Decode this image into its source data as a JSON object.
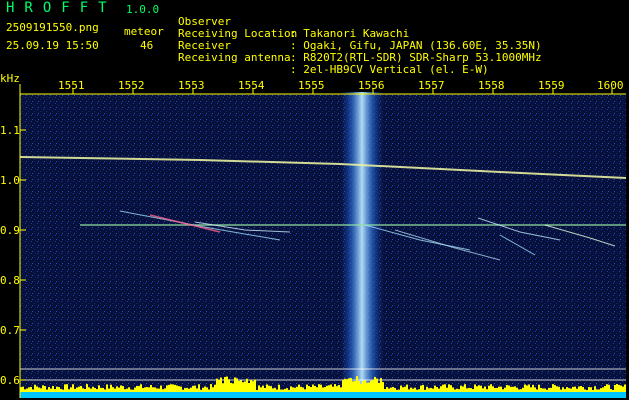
{
  "header": {
    "app_name": "HROFFT",
    "version": "1.0.0",
    "filename": "2509191550.png",
    "datetime": "25.09.19 15:50",
    "meteor_label": "meteor",
    "meteor_count": "46"
  },
  "metadata": [
    {
      "key": "Observer",
      "value": ": Takanori Kawachi"
    },
    {
      "key": "Receiving Location",
      "value": ": Ogaki, Gifu, JAPAN (136.60E, 35.35N)"
    },
    {
      "key": "Receiver",
      "value": ": R820T2(RTL-SDR) SDR-Sharp 53.1000MHz"
    },
    {
      "key": "Receiving antenna",
      "value": ": 2el-HB9CV Vertical (el. E-W)"
    }
  ],
  "axes": {
    "y_unit": "kHz",
    "y_ticks": [
      "1.1",
      "1.0",
      "0.9",
      "0.8",
      "0.7",
      "0.6"
    ],
    "x_ticks": [
      "1551",
      "1552",
      "1553",
      "1554",
      "1555",
      "1556",
      "1557",
      "1558",
      "1559",
      "1600"
    ]
  },
  "colors": {
    "background": "#000000",
    "waterfall_base": "#08103a",
    "text": "#ffff00",
    "app_title": "#00ff66",
    "spectrum_bars": "#ffff00",
    "baseline": "#00c8ff"
  }
}
